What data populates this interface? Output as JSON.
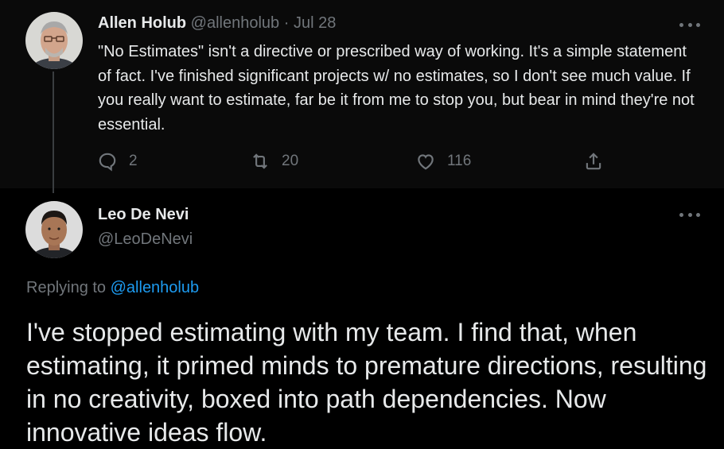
{
  "parent_tweet": {
    "display_name": "Allen Holub",
    "handle": "@allenholub",
    "separator": "·",
    "date": "Jul 28",
    "text": "\"No Estimates\" isn't a directive or prescribed way of working. It's a simple statement of fact. I've finished significant projects w/ no estimates, so I don't see much value. If you really want to estimate, far be it from me to stop you, but bear in mind they're not essential.",
    "reply_count": "2",
    "retweet_count": "20",
    "like_count": "116"
  },
  "reply_tweet": {
    "display_name": "Leo De Nevi",
    "handle": "@LeoDeNevi",
    "replying_prefix": "Replying to",
    "replying_mention": "@allenholub",
    "text": "I've stopped estimating with my team. I find that, when estimating, it primed minds to premature directions, resulting in no creativity, boxed into path dependencies. Now innovative ideas flow."
  },
  "colors": {
    "background": "#000000",
    "text_primary": "#e7e9ea",
    "text_muted": "#71767b",
    "link": "#1d9bf0"
  },
  "icons": {
    "more": "more-dots-icon",
    "reply": "reply-bubble-icon",
    "retweet": "retweet-icon",
    "like": "heart-icon",
    "share": "share-icon"
  }
}
